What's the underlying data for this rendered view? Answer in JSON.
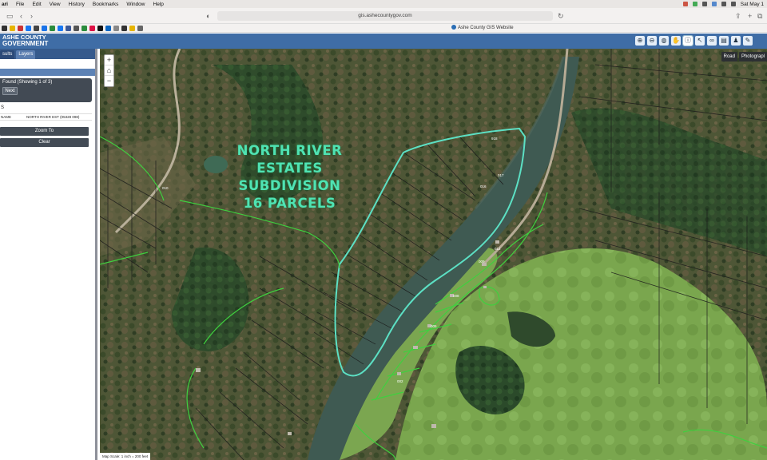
{
  "menubar": {
    "app": "ari",
    "items": [
      "File",
      "Edit",
      "View",
      "History",
      "Bookmarks",
      "Window",
      "Help"
    ],
    "clock": "Sat May 1"
  },
  "browser": {
    "url": "gis.ashecountygov.com",
    "tab_title": "Ashe County GIS Website"
  },
  "app": {
    "logo_line1": "ASHE COUNTY",
    "logo_line2": "GOVERNMENT",
    "tools": [
      "zoom-in-icon",
      "zoom-out-icon",
      "globe-icon",
      "pan-hand-icon",
      "info-icon",
      "select-arrow-icon",
      "binoculars-icon",
      "print-icon",
      "person-icon",
      "pencil-icon"
    ]
  },
  "sidebar": {
    "tabs": [
      "sults",
      "Layers"
    ],
    "found_text": "Found (Showing 1 of 3)",
    "next_label": "Next",
    "section_label": "S",
    "result_key": "NAME",
    "result_value": "NORTH RIVER EST (05328 098)",
    "zoom_to_label": "Zoom To",
    "clear_label": "Clear"
  },
  "map": {
    "annotation": [
      "NORTH RIVER",
      "ESTATES",
      "SUBDIVISION",
      "16 PARCELS"
    ],
    "basemaps": [
      "Road",
      "Photograpl"
    ],
    "scale_text": "Map Scale: 1 inch = 200 feet",
    "zoom_in": "+",
    "home": "⌂",
    "zoom_out": "−",
    "parcel_labels": [
      "918",
      "017",
      "016",
      "012",
      "009",
      "008",
      "005",
      "002",
      "010"
    ],
    "colors": {
      "subdivision_outline": "#5ce0c4",
      "parcel_line": "#1b1b1b",
      "lot_line": "#3fd03f",
      "river": "#3f5a52",
      "pasture": "#7aa64e"
    }
  }
}
